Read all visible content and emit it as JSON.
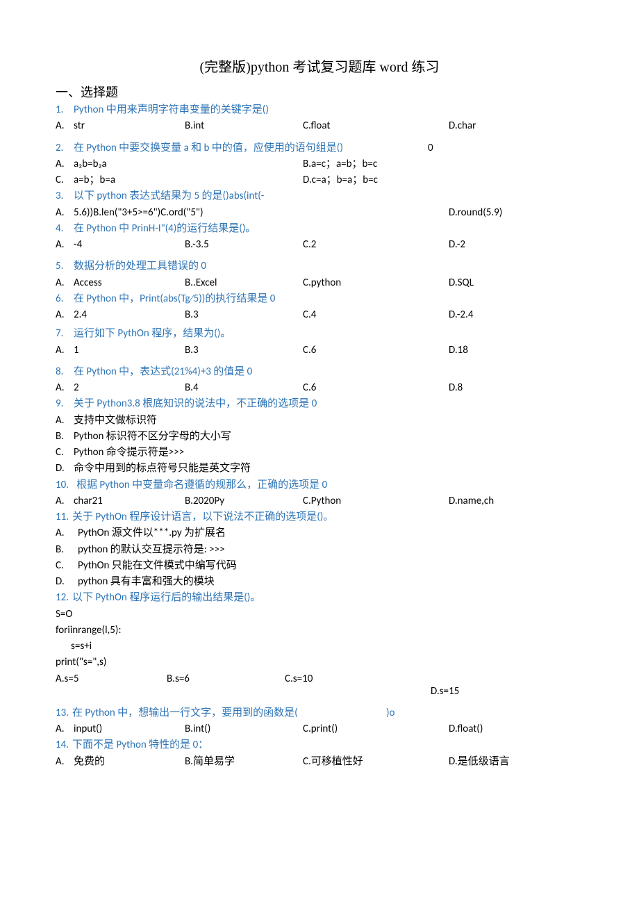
{
  "title": "(完整版)python 考试复习题库 word 练习",
  "section1": "一、选择题",
  "q1": {
    "num": "1.",
    "text": "Python 中用来声明字符串变量的关键字是()",
    "a": "str",
    "b": "B.int",
    "c": "C.float",
    "d": "D.char",
    "al": "A."
  },
  "q2": {
    "num": "2.",
    "text": "在 Python 中要交换变量 a 和 b 中的值，应使用的语句组是()",
    "tail": "0",
    "r1a": "a₂b=b₂a",
    "r1b": "B.a=c；a=b；b=c",
    "al1": "A.",
    "r2a": "a=b；b=a",
    "r2b": "D.c=a；b=a；b=c",
    "al2": "C."
  },
  "q3": {
    "num": "3.",
    "text": "以下 python 表达式结果为 5 的是()abs(int(-",
    "al": "A.",
    "line2": "5.6))B.len(\"3+5>=6\")C.ord(\"5\")",
    "d": "D.round(5.9)"
  },
  "q4": {
    "num": "4.",
    "text": "在 Python 中 PrinH-I\"(4)的运行结果是()。",
    "al": "A.",
    "a": "-4",
    "b": "B.-3.5",
    "c": "C.2",
    "d": "D.-2"
  },
  "q5": {
    "num": "5.",
    "text": "数据分析的处理工具错误的 0",
    "al": "A.",
    "a": "Access",
    "b": "B..Excel",
    "c": "C.python",
    "d": "D.SQL"
  },
  "q6": {
    "num": "6.",
    "text": "在 Python 中，Print(abs(Tg∕5))的执行结果是 0",
    "al": "A.",
    "a": "2.4",
    "b": "B.3",
    "c": "C.4",
    "d": "D.-2.4"
  },
  "q7": {
    "num": "7.",
    "text": "运行如下 PythOn 程序，结果为()。",
    "al": "A.",
    "a": "1",
    "b": "B.3",
    "c": "C.6",
    "d": "D.18"
  },
  "q8": {
    "num": "8.",
    "text": "在 Python 中，表达式(21%4)+3 的值是 0",
    "al": "A.",
    "a": "2",
    "b": "B.4",
    "c": "C.6",
    "d": "D.8"
  },
  "q9": {
    "num": "9.",
    "text": "关于 Python3.8 根底知识的说法中，不正确的选项是 0",
    "al": "A.",
    "a": "支持中文做标识符",
    "bl": "B.",
    "b": "Python 标识符不区分字母的大小写",
    "cl": "C.",
    "c": "Python 命令提示符是>>>",
    "dl": "D.",
    "d": "命令中用到的标点符号只能是英文字符"
  },
  "q10": {
    "num": "10.",
    "text": "根据 Python 中变量命名遵循的规那么，正确的选项是 0",
    "al": "A.",
    "a": "char21",
    "b": "B.2020Py",
    "c": "C.Python",
    "d": "D.name,ch"
  },
  "q11": {
    "num": "11.",
    "text": "关于 PythOn 程序设计语言，以下说法不正确的选项是()。",
    "al": "A.",
    "a": "PythOn 源文件以***.py 为扩展名",
    "bl": "B.",
    "b": "python 的默认交互提示符是: >>>",
    "cl": "C.",
    "c": "PythOn 只能在文件模式中编写代码",
    "dl": "D.",
    "d": "python 具有丰富和强大的模块"
  },
  "q12": {
    "num": "12.",
    "text": "以下 PythOn 程序运行后的输出结果是()。",
    "code1": "S=O",
    "code2": "foriinrange(l,5):",
    "code3": "s=s+i",
    "code4": "print(\"s=\",s)",
    "a": "A.s=5",
    "b": "B.s=6",
    "c": "C.s=10",
    "d": "D.s=15"
  },
  "q13": {
    "num": "13.",
    "text": "在 Python 中，想输出一行文字，要用到的函数是(",
    "tail": ")o",
    "al": "A.",
    "a": "input()",
    "b": "B.int()",
    "c": "C.print()",
    "d": "D.float()"
  },
  "q14": {
    "num": "14.",
    "text": "下面不是 Python 特性的是 0：",
    "al": "A.",
    "a": "免费的",
    "b": "B.简单易学",
    "c": "C.可移植性好",
    "d": "D.是低级语言"
  }
}
